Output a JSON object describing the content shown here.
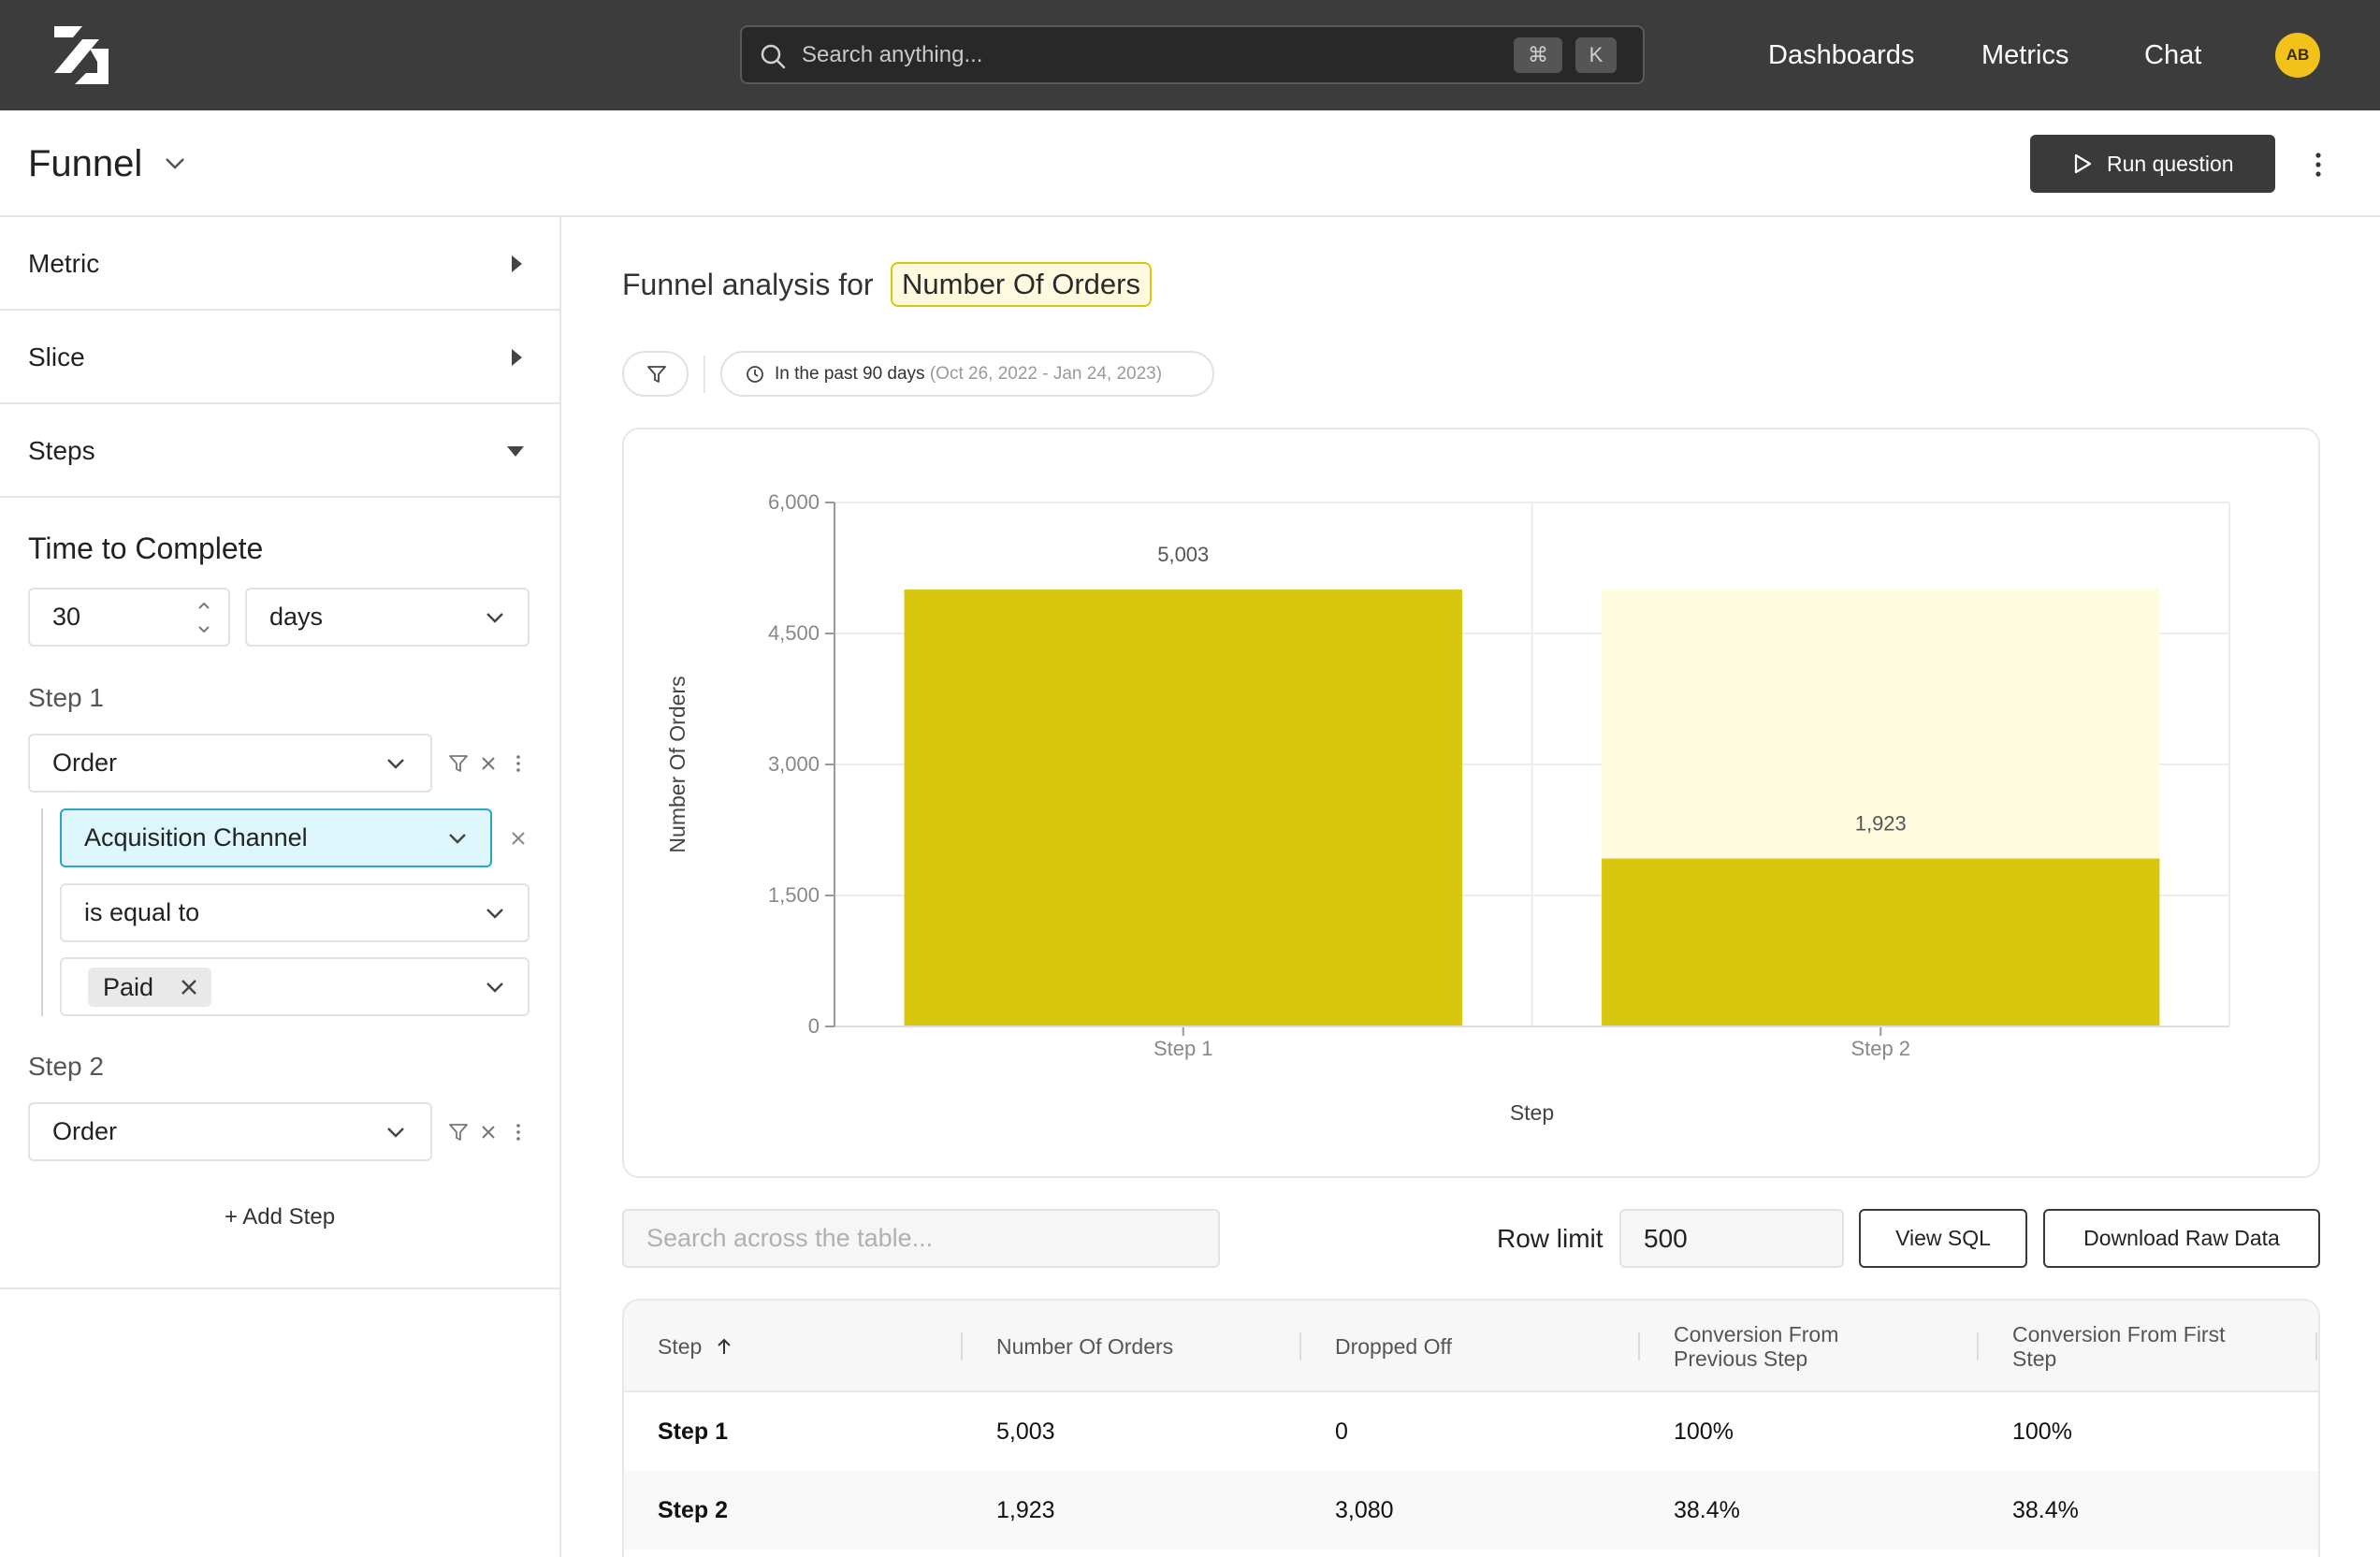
{
  "header": {
    "search_placeholder": "Search anything...",
    "shortcut_keys": [
      "⌘",
      "K"
    ],
    "nav": [
      "Dashboards",
      "Metrics",
      "Chat"
    ],
    "avatar_initials": "AB"
  },
  "page": {
    "title": "Funnel",
    "run_label": "Run question"
  },
  "sidebar": {
    "sections": [
      "Metric",
      "Slice",
      "Steps"
    ],
    "time_to_complete": {
      "label": "Time to Complete",
      "value": "30",
      "unit": "days"
    },
    "steps": [
      {
        "label": "Step 1",
        "event": "Order",
        "filter": {
          "field": "Acquisition Channel",
          "operator": "is equal to",
          "values": [
            "Paid"
          ]
        }
      },
      {
        "label": "Step 2",
        "event": "Order"
      }
    ],
    "add_step": "+ Add Step"
  },
  "main": {
    "heading_prefix": "Funnel analysis for",
    "metric_name": "Number Of Orders",
    "date_filter": {
      "label": "In the past 90 days",
      "range": "(Oct 26, 2022 - Jan 24, 2023)"
    }
  },
  "chart_data": {
    "type": "bar",
    "categories": [
      "Step 1",
      "Step 2"
    ],
    "series": [
      {
        "values": [
          5003,
          1923
        ]
      },
      {
        "values": [
          0,
          3080
        ]
      }
    ],
    "data_labels": [
      "5,003",
      "1,923"
    ],
    "xlabel": "Step",
    "ylabel": "Number Of Orders",
    "ylim": [
      0,
      6000
    ],
    "yticks": [
      "0",
      "1,500",
      "3,000",
      "4,500",
      "6,000"
    ],
    "stacked": true,
    "colors": [
      "#d9c70f",
      "#fffbdf"
    ],
    "grid": true
  },
  "table": {
    "search_placeholder": "Search across the table...",
    "row_limit_label": "Row limit",
    "row_limit_value": "500",
    "view_sql": "View SQL",
    "download": "Download Raw Data",
    "columns": [
      "Step",
      "Number Of Orders",
      "Dropped Off",
      "Conversion From Previous Step",
      "Conversion From First Step"
    ],
    "rows": [
      [
        "Step 1",
        "5,003",
        "0",
        "100%",
        "100%"
      ],
      [
        "Step 2",
        "1,923",
        "3,080",
        "38.4%",
        "38.4%"
      ]
    ]
  },
  "colors": {
    "topbar": "#3c3c3c",
    "accent": "#d9c70f",
    "accent_light": "#fffbdf",
    "selected_field": "#def7fc",
    "avatar": "#f2c21b"
  }
}
